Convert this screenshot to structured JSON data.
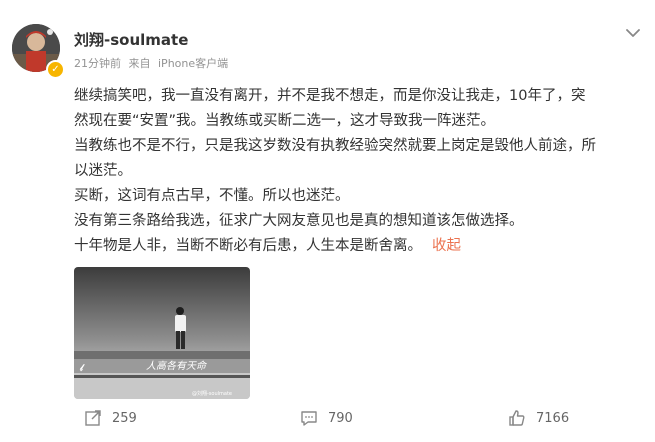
{
  "post": {
    "author": {
      "name": "刘翔-soulmate",
      "verified_icon": "verified-badge-icon"
    },
    "meta": {
      "time": "21分钟前",
      "source_prefix": "来自",
      "source": "iPhone客户端"
    },
    "content": {
      "lines": [
        "继续搞笑吧，我一直没有离开，并不是我不想走，而是你没让我走，10年了，突",
        "然现在要“安置”我。当教练或买断二选一，这才导致我一阵迷茫。",
        "当教练也不是不行，只是我这岁数没有执教经验突然就要上岗定是毁他人前途，所",
        "以迷茫。",
        "买断，这词有点古早，不懂。所以也迷茫。",
        "没有第三条路给我选，征求广大网友意见也是真的想知道该怎做选择。",
        "十年物是人非，当断不断必有后患，人生本是断舍离。"
      ],
      "collapse_label": "收起"
    },
    "image": {
      "calligraphy": "人高各有天命",
      "watermark": "@刘翔-soulmate"
    },
    "actions": {
      "repost_count": "259",
      "comment_count": "790",
      "like_count": "7166"
    }
  },
  "colors": {
    "link": "#eb7350",
    "meta": "#939393",
    "verified": "#f7b500"
  }
}
